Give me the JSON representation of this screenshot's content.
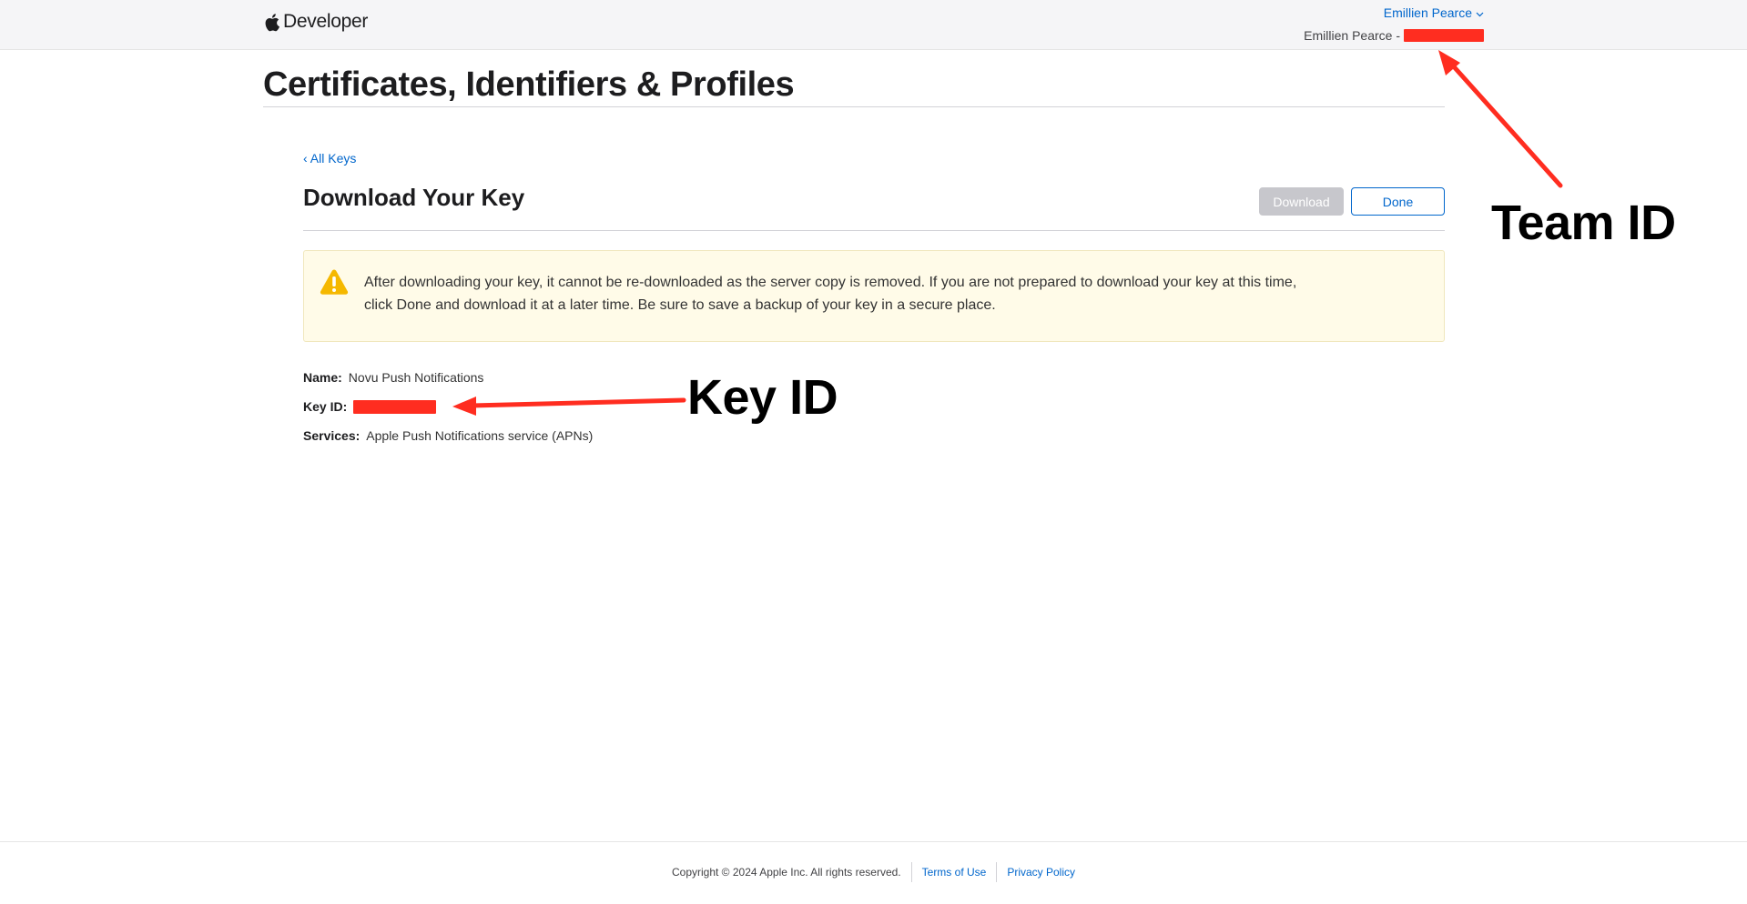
{
  "header": {
    "brand_icon": "apple-logo-icon",
    "brand_label": "Developer",
    "account_name": "Emillien Pearce",
    "account_team": "Emillien Pearce - "
  },
  "page": {
    "title": "Certificates, Identifiers & Profiles"
  },
  "key_page": {
    "back_link": "‹ All Keys",
    "title": "Download Your Key",
    "download_label": "Download",
    "done_label": "Done",
    "warning_icon": "warning-icon",
    "warning_text": "After downloading your key, it cannot be re-downloaded as the server copy is removed. If you are not prepared to download your key at this time, click Done and download it at a later time. Be sure to save a backup of your key in a secure place.",
    "details": {
      "name_label": "Name:",
      "name_value": "Novu Push Notifications",
      "keyid_label": "Key ID:",
      "services_label": "Services:",
      "services_value": "Apple Push Notifications service (APNs)"
    }
  },
  "annotations": {
    "team_id": "Team ID",
    "key_id": "Key ID",
    "arrow_color": "#ff2d20"
  },
  "footer": {
    "copyright": "Copyright © 2024 Apple Inc. All rights reserved.",
    "terms": "Terms of Use",
    "privacy": "Privacy Policy"
  }
}
